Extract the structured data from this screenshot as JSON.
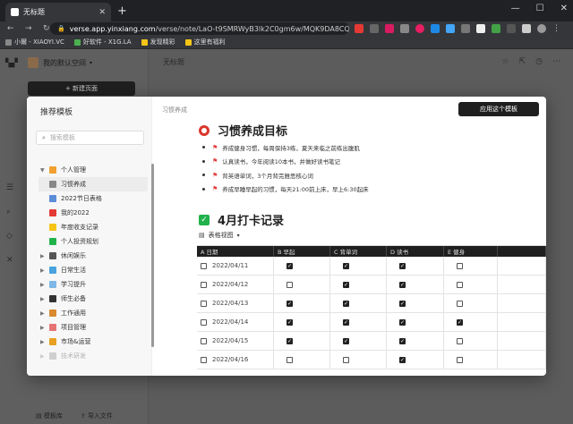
{
  "browser": {
    "tab_title": "无标题",
    "url_domain": "verse.app.yinxiang.com",
    "url_path": "/verse/note/LaO-t9SMRWyB3lk2C0gm6w/MQK9DA8CQa-q...",
    "bookmarks": [
      "小爾 - XIAOYI.VC",
      "好软件 - X1G.LA",
      "发现精彩",
      "这里有福利"
    ]
  },
  "sidebar": {
    "workspace": "我的默认空间",
    "new_page": "+ 新建页面",
    "footer": [
      "模板库",
      "导入文件"
    ]
  },
  "doc": {
    "title": "无标题"
  },
  "modal": {
    "title": "推荐模板",
    "search_placeholder": "搜索模板",
    "breadcrumb": "习惯养成",
    "apply_button": "应用这个模板",
    "tree": [
      {
        "label": "个人管理",
        "expanded": true,
        "color": "#f0a030"
      },
      {
        "label": "习惯养成",
        "child": true,
        "selected": true,
        "color": "#888888"
      },
      {
        "label": "2022节日表格",
        "child": true,
        "color": "#5a8ed8"
      },
      {
        "label": "我的2022",
        "child": true,
        "color": "#e53935"
      },
      {
        "label": "年度收支记录",
        "child": true,
        "color": "#f5c518"
      },
      {
        "label": "个人投资规划",
        "child": true,
        "color": "#21b24a"
      },
      {
        "label": "休闲娱乐",
        "color": "#555555"
      },
      {
        "label": "日常生活",
        "color": "#4aa3df"
      },
      {
        "label": "学习提升",
        "color": "#7fb8e6"
      },
      {
        "label": "师生必备",
        "color": "#333333"
      },
      {
        "label": "工作通用",
        "color": "#d98a30"
      },
      {
        "label": "项目管理",
        "color": "#e57373"
      },
      {
        "label": "市场&运营",
        "color": "#e8a020"
      },
      {
        "label": "技术研发",
        "color": "#888888",
        "fade": true
      }
    ],
    "content": {
      "h1": "习惯养成目标",
      "bullets": [
        "养成健身习惯，每周保持3练，夏天来临之前练出腹肌",
        "认真读书，今年阅读10本书，并做好读书笔记",
        "背英语单词，3个月背完雅思核心词",
        "养成早睡早起的习惯，每天21:00前上床，早上6:30起床"
      ],
      "h2": "4月打卡记录",
      "view_label": "表格视图",
      "table": {
        "headers": [
          "A  日期",
          "B  早起",
          "C  背单词",
          "D  读书",
          "E  健身",
          ""
        ],
        "rows": [
          {
            "date": "2022/04/11",
            "checks": [
              true,
              true,
              true,
              false
            ]
          },
          {
            "date": "2022/04/12",
            "checks": [
              false,
              true,
              true,
              false
            ]
          },
          {
            "date": "2022/04/13",
            "checks": [
              true,
              true,
              true,
              false
            ]
          },
          {
            "date": "2022/04/14",
            "checks": [
              true,
              true,
              true,
              true
            ]
          },
          {
            "date": "2022/04/15",
            "checks": [
              true,
              true,
              true,
              false
            ]
          },
          {
            "date": "2022/04/16",
            "checks": [
              false,
              false,
              true,
              false
            ]
          }
        ]
      }
    }
  }
}
